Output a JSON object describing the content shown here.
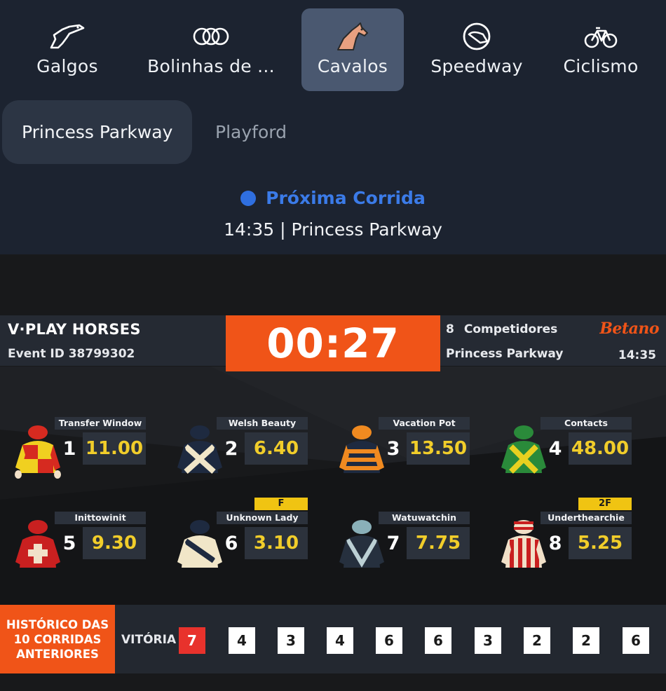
{
  "sport_tabs": [
    {
      "label": "Galgos",
      "icon": "greyhound-icon",
      "active": false
    },
    {
      "label": "Bolinhas de ...",
      "icon": "lottery-balls-icon",
      "active": false
    },
    {
      "label": "Cavalos",
      "icon": "horse-icon",
      "active": true
    },
    {
      "label": "Speedway",
      "icon": "helmet-icon",
      "active": false
    },
    {
      "label": "Ciclismo",
      "icon": "bicycle-icon",
      "active": false
    }
  ],
  "venue_tabs": [
    {
      "label": "Princess Parkway",
      "active": true
    },
    {
      "label": "Playford",
      "active": false
    }
  ],
  "next_race": {
    "title": "Próxima Corrida",
    "subtitle": "14:35 | Princess Parkway"
  },
  "stream": {
    "brand": "V·PLAY HORSES",
    "event_id": "Event ID 38799302",
    "countdown": "00:27",
    "competitors_count": "8",
    "competitors_label": "Competidores",
    "logo": "Betano",
    "venue": "Princess Parkway",
    "time": "14:35",
    "runners": [
      {
        "number": "1",
        "name": "Transfer Window",
        "odds": "11.00",
        "badge": ""
      },
      {
        "number": "2",
        "name": "Welsh Beauty",
        "odds": "6.40",
        "badge": ""
      },
      {
        "number": "3",
        "name": "Vacation Pot",
        "odds": "13.50",
        "badge": ""
      },
      {
        "number": "4",
        "name": "Contacts",
        "odds": "48.00",
        "badge": ""
      },
      {
        "number": "5",
        "name": "Inittowinit",
        "odds": "9.30",
        "badge": ""
      },
      {
        "number": "6",
        "name": "Unknown Lady",
        "odds": "3.10",
        "badge": "F"
      },
      {
        "number": "7",
        "name": "Watuwatchin",
        "odds": "7.75",
        "badge": ""
      },
      {
        "number": "8",
        "name": "Underthearchie",
        "odds": "5.25",
        "badge": "2F"
      }
    ],
    "history": {
      "label_line1": "HISTÓRICO DAS",
      "label_line2": "10 CORRIDAS",
      "label_line3": "ANTERIORES",
      "win_label": "VITÓRIA",
      "results": [
        "7",
        "4",
        "3",
        "4",
        "6",
        "6",
        "3",
        "2",
        "2",
        "6"
      ]
    }
  },
  "colors": {
    "background": "#1c2330",
    "active_tab": "#4a5870",
    "accent_blue": "#3b7be8",
    "brand_orange": "#f05418",
    "odds_yellow": "#f1cd2a"
  }
}
